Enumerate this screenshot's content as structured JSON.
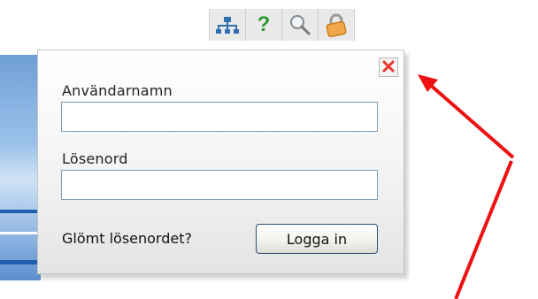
{
  "toolbar": {
    "icons": [
      "sitemap-icon",
      "help-icon",
      "search-icon",
      "lock-icon"
    ],
    "help_glyph": "?"
  },
  "login": {
    "username_label": "Användarnamn",
    "username_value": "",
    "password_label": "Lösenord",
    "password_value": "",
    "forgot_link": "Glömt lösenordet?",
    "submit_label": "Logga in"
  },
  "colors": {
    "close_x": "#e8372c",
    "annotation_arrow": "#ee1111",
    "help_icon": "#2e9b2e",
    "input_border": "#7f9db9"
  }
}
